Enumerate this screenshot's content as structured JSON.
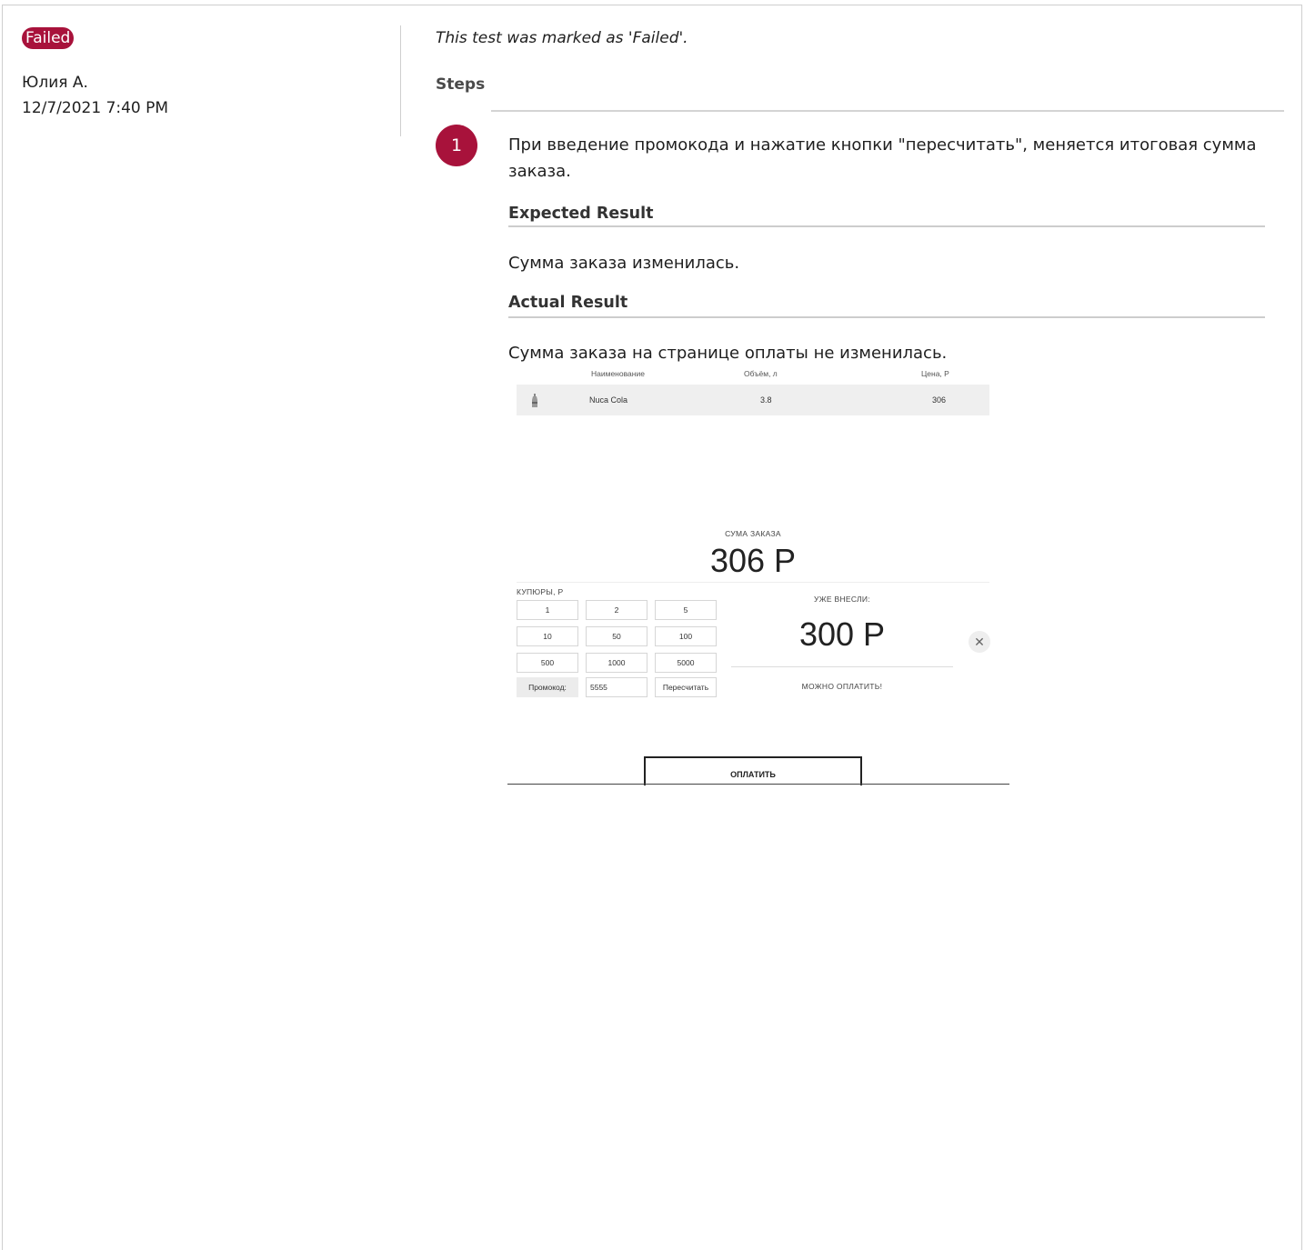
{
  "status": {
    "label": "Failed",
    "color": "#a8123b"
  },
  "author": "Юлия А.",
  "timestamp": "12/7/2021 7:40 PM",
  "note": "This test was marked as 'Failed'.",
  "steps_title": "Steps",
  "step": {
    "number": "1",
    "text": "При введение промокода и нажатие кнопки \"пересчитать\", меняется итоговая сумма заказа.",
    "expected_title": "Expected Result",
    "expected": "Сумма заказа изменилась.",
    "actual_title": "Actual Result",
    "actual": "Сумма заказа на странице оплаты не изменилась."
  },
  "screenshot": {
    "headers": [
      "Наименование",
      "Объём, л",
      "Цена, Р"
    ],
    "item": {
      "icon": "bottle-icon",
      "name": "Nuca Cola",
      "volume": "3.8",
      "price": "306"
    },
    "total_label": "СУМА ЗАКАЗА",
    "total": "306 Р",
    "bills_label": "КУПЮРЫ, Р",
    "bills": [
      "1",
      "2",
      "5",
      "10",
      "50",
      "100",
      "500",
      "1000",
      "5000"
    ],
    "promo_label": "Промокод:",
    "promo_value": "5555",
    "recalc": "Пересчитать",
    "paid_label": "УЖЕ ВНЕСЛИ:",
    "paid": "300 Р",
    "close_icon": "close-icon",
    "status_msg": "МОЖНО ОПЛАТИТЬ!",
    "pay": "ОПЛАТИТЬ"
  }
}
